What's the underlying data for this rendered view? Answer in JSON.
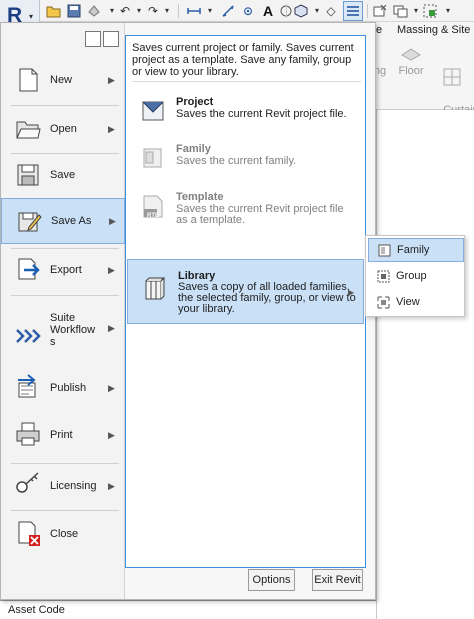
{
  "app": {
    "logo_letter": "R"
  },
  "quick_access": {
    "icons": [
      "open-icon",
      "save-icon",
      "sync-icon",
      "undo-icon",
      "redo-icon",
      "measure-icon",
      "dimension-icon",
      "tag-icon",
      "text-icon",
      "3d-view-icon",
      "section-icon",
      "thin-lines-icon",
      "close-windows-icon",
      "switch-windows-icon",
      "dropdown-icon"
    ]
  },
  "ribbon": {
    "tab_partial": "e",
    "tab_massing": "Massing & Site",
    "buttons": [
      {
        "label": "ng"
      },
      {
        "label": "Floor"
      },
      {
        "label": "Curtain\nSystem"
      }
    ]
  },
  "menu": {
    "items": [
      {
        "label": "New",
        "icon": "new-icon",
        "has_submenu": true
      },
      {
        "label": "Open",
        "icon": "open-folder-icon",
        "has_submenu": true
      },
      {
        "label": "Save",
        "icon": "save-disk-icon",
        "has_submenu": false
      },
      {
        "label": "Save As",
        "icon": "save-as-icon",
        "has_submenu": true
      },
      {
        "label": "Export",
        "icon": "export-icon",
        "has_submenu": true
      },
      {
        "label": "Suite\nWorkflow\ns",
        "icon": "suite-workflows-icon",
        "has_submenu": true
      },
      {
        "label": "Publish",
        "icon": "publish-icon",
        "has_submenu": true
      },
      {
        "label": "Print",
        "icon": "print-icon",
        "has_submenu": true
      },
      {
        "label": "Licensing",
        "icon": "licensing-key-icon",
        "has_submenu": true
      },
      {
        "label": "Close",
        "icon": "close-document-icon",
        "has_submenu": false
      }
    ],
    "selected": "Save As"
  },
  "save_as_panel": {
    "description": "Saves current project or family. Saves current project as a template. Save any family, group or view to your library.",
    "options": [
      {
        "title": "Project",
        "desc": "Saves the current Revit project file.",
        "enabled": true
      },
      {
        "title": "Family",
        "desc": "Saves the current family.",
        "enabled": false
      },
      {
        "title": "Template",
        "desc": "Saves the current Revit project file as a template.",
        "enabled": false
      },
      {
        "title": "Library",
        "desc": "Saves a copy of all loaded families, the selected family, group, or view to your library.",
        "enabled": true,
        "has_submenu": true
      }
    ],
    "template_badge": "RTE"
  },
  "library_submenu": {
    "items": [
      {
        "label": "Family",
        "icon": "family-icon"
      },
      {
        "label": "Group",
        "icon": "group-icon"
      },
      {
        "label": "View",
        "icon": "view-icon"
      }
    ]
  },
  "buttons": {
    "options": "Options",
    "exit": "Exit Revit"
  },
  "properties": {
    "asset_code": "Asset Code"
  }
}
